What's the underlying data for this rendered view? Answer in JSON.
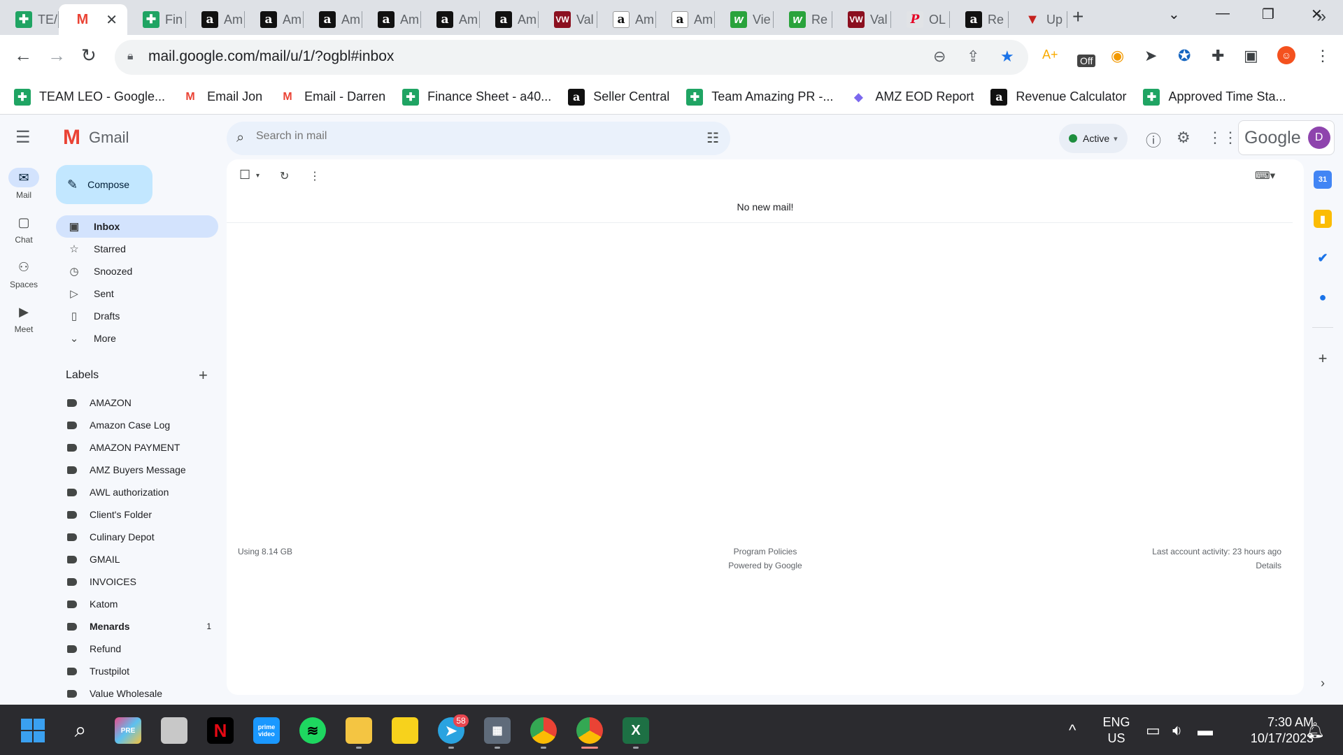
{
  "browser": {
    "tabs": [
      {
        "label": "TEAM LEO - Google...",
        "short": "TE/",
        "favicon": "sheets"
      },
      {
        "label": "Gmail",
        "short": "",
        "favicon": "gmail",
        "active": true
      },
      {
        "label": "Finance Sheet",
        "short": "Fin",
        "favicon": "sheets"
      },
      {
        "label": "Amazon",
        "short": "Am",
        "favicon": "amazon"
      },
      {
        "label": "Amazon",
        "short": "Am",
        "favicon": "amazon"
      },
      {
        "label": "Amazon",
        "short": "Am",
        "favicon": "amazon"
      },
      {
        "label": "Amazon",
        "short": "Am",
        "favicon": "amazon"
      },
      {
        "label": "Amazon",
        "short": "Am",
        "favicon": "amazon"
      },
      {
        "label": "Amazon",
        "short": "Am",
        "favicon": "amazon"
      },
      {
        "label": "Value Wholesale",
        "short": "Val",
        "favicon": "vw"
      },
      {
        "label": "Amazon",
        "short": "Am",
        "favicon": "amazon-white"
      },
      {
        "label": "Amazon",
        "short": "Am",
        "favicon": "amazon-white"
      },
      {
        "label": "View",
        "short": "Vie",
        "favicon": "nw"
      },
      {
        "label": "Re",
        "short": "Re",
        "favicon": "nw"
      },
      {
        "label": "Value Wholesale",
        "short": "Val",
        "favicon": "vw"
      },
      {
        "label": "OL",
        "short": "OL",
        "favicon": "pinterest"
      },
      {
        "label": "Revenue",
        "short": "Re",
        "favicon": "amazon"
      },
      {
        "label": "Up",
        "short": "Up",
        "favicon": "up"
      }
    ],
    "close_glyph": "✕",
    "new_tab_glyph": "+",
    "url": "mail.google.com/mail/u/1/?ogbl#inbox",
    "bookmarks": [
      {
        "label": "TEAM LEO - Google...",
        "favicon": "sheets"
      },
      {
        "label": "Email Jon",
        "favicon": "gmail"
      },
      {
        "label": "Email - Darren",
        "favicon": "gmail"
      },
      {
        "label": "Finance Sheet - a40...",
        "favicon": "sheets"
      },
      {
        "label": "Seller Central",
        "favicon": "amazon"
      },
      {
        "label": "Team Amazing PR -...",
        "favicon": "sheets"
      },
      {
        "label": "AMZ EOD Report",
        "favicon": "clickup"
      },
      {
        "label": "Revenue Calculator",
        "favicon": "amazon"
      },
      {
        "label": "Approved Time Sta...",
        "favicon": "sheets"
      }
    ],
    "ext_off_label": "Off"
  },
  "gmail": {
    "app_name": "Gmail",
    "search_placeholder": "Search in mail",
    "status": "Active",
    "google_label": "Google",
    "avatar_initial": "D",
    "rail": [
      {
        "label": "Mail",
        "icon": "mail-icon"
      },
      {
        "label": "Chat",
        "icon": "chat-icon"
      },
      {
        "label": "Spaces",
        "icon": "spaces-icon"
      },
      {
        "label": "Meet",
        "icon": "meet-icon"
      }
    ],
    "compose": "Compose",
    "nav": [
      {
        "label": "Inbox",
        "icon": "inbox-icon"
      },
      {
        "label": "Starred",
        "icon": "star-icon"
      },
      {
        "label": "Snoozed",
        "icon": "clock-icon"
      },
      {
        "label": "Sent",
        "icon": "send-icon"
      },
      {
        "label": "Drafts",
        "icon": "draft-icon"
      },
      {
        "label": "More",
        "icon": "chevron-down-icon"
      }
    ],
    "labels_title": "Labels",
    "labels": [
      {
        "label": "AMAZON"
      },
      {
        "label": "Amazon Case Log"
      },
      {
        "label": "AMAZON PAYMENT"
      },
      {
        "label": "AMZ Buyers Message"
      },
      {
        "label": "AWL authorization"
      },
      {
        "label": "Client's Folder"
      },
      {
        "label": "Culinary Depot"
      },
      {
        "label": "GMAIL"
      },
      {
        "label": "INVOICES"
      },
      {
        "label": "Katom"
      },
      {
        "label": "Menards",
        "count": "1",
        "bold": true
      },
      {
        "label": "Refund"
      },
      {
        "label": "Trustpilot"
      },
      {
        "label": "Value Wholesale"
      }
    ],
    "empty_message": "No new mail!",
    "storage": "Using 8.14 GB",
    "footer_links": [
      "Program Policies",
      "Powered by Google"
    ],
    "activity": "Last account activity: 23 hours ago",
    "details": "Details"
  },
  "taskbar": {
    "telegram_badge": "58",
    "lang": "ENG",
    "region": "US",
    "time": "7:30 AM",
    "date": "10/17/2023"
  }
}
